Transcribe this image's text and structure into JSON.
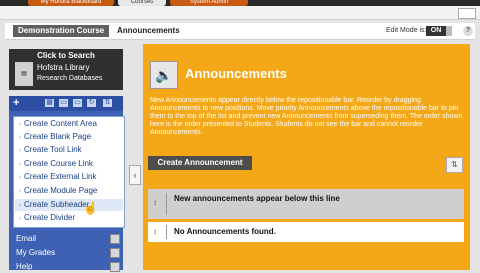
{
  "top_tabs": [
    "My Hofstra Blackboard",
    "Courses",
    "System Admin"
  ],
  "course_bar": {
    "course_name": "Demonstration Course",
    "breadcrumb": "Announcements",
    "edit_mode_label": "Edit Mode is:",
    "edit_mode_value": "ON",
    "help_icon": "?"
  },
  "library_banner": {
    "title": "Click to Search",
    "line1": "Hofstra Library",
    "line2": "Research Databases"
  },
  "add_menu": {
    "items": [
      "Create Content Area",
      "Create Blank Page",
      "Create Tool Link",
      "Create Course Link",
      "Create External Link",
      "Create Module Page",
      "Create Subheader",
      "Create Divider"
    ],
    "hovered_index": 6
  },
  "nav_items": [
    "Email",
    "My Grades",
    "Help"
  ],
  "main": {
    "title": "Announcements",
    "help_text": "New Announcements appear directly below the repositionable bar. Reorder by dragging Announcements to new positions. Move priority Announcements above the repositionable bar to pin them to the top of the list and prevent new Announcements from superseding them. The order shown here is the order presented to Students. Students do not see the bar and cannot reorder Announcements.",
    "create_button": "Create Announcement",
    "rows": [
      "New announcements appear below this line",
      "No Announcements found."
    ]
  },
  "colors": {
    "panel": "#f4a817",
    "sidebar": "#3f61b3",
    "dark_bar": "#2a2a2a",
    "button": "#4d4d4d"
  },
  "icons": {
    "page_icon": "speaker-icon",
    "sort_icon": "sort-arrows-icon",
    "collapse_icon": "chevron-left-icon"
  }
}
